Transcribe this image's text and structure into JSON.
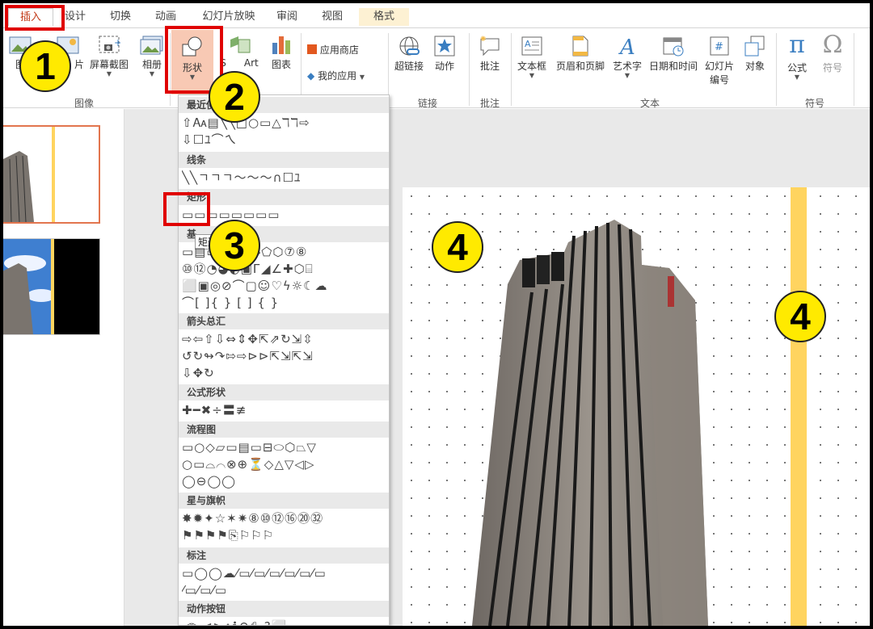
{
  "tabs": [
    {
      "label": "插入",
      "active": true
    },
    {
      "label": "设计"
    },
    {
      "label": "切换"
    },
    {
      "label": "动画"
    },
    {
      "label": "幻灯片放映"
    },
    {
      "label": "审阅"
    },
    {
      "label": "视图"
    },
    {
      "label": "格式",
      "context": true
    }
  ],
  "ribbon": {
    "images_group": {
      "label": "图像",
      "picture_label": "图",
      "online_picture_label": "片",
      "screenshot_label": "屏幕截图",
      "album_label": "相册"
    },
    "illustrations": {
      "shapes_label": "形状",
      "smartart_label_a": "S",
      "smartart_label_b": "Art",
      "chart_label": "图表"
    },
    "apps": {
      "store_label": "应用商店",
      "myapps_label": "我的应用"
    },
    "links_group": {
      "label": "链接",
      "hyperlink_label": "超链接",
      "action_label": "动作"
    },
    "comments_group": {
      "label": "批注",
      "comment_label": "批注"
    },
    "text_group": {
      "label": "文本",
      "textbox_label": "文本框",
      "header_footer_label": "页眉和页脚",
      "wordart_label": "艺术字",
      "datetime_label": "日期和时间",
      "slide_number_label_1": "幻灯片",
      "slide_number_label_2": "编号",
      "object_label": "对象"
    },
    "symbols_group": {
      "label": "符号",
      "equation_label": "公式",
      "symbol_label": "符号"
    }
  },
  "shapes_menu": {
    "recent_title": "最近使",
    "lines_title": "线条",
    "rect_title": "矩形",
    "basic_title": "基",
    "arrows_title": "箭头总汇",
    "equation_title": "公式形状",
    "flowchart_title": "流程图",
    "stars_title": "星与旗帜",
    "callouts_title": "标注",
    "action_title": "动作按钮",
    "tooltip": "矩形",
    "rows": {
      "recent_1": "⇧🗛▤╲╲□○▭△ℸℸ⇨",
      "recent_2": "⇩☐ﾕ⌒ㄟ",
      "lines_1": "╲╲ㄱㄱㄱ～～～∩☐ﾕ",
      "rect_1": "▭▭▭▭▭▭▭▭",
      "basic_1": "▭▤▭▭▱◁◇⬠⬡⑦⑧",
      "basic_2": "⑩⑫◔◕◐▣Г◢∠✚⬡⌸",
      "basic_3": "⬜▣◎⊘⌒▢☺♡ϟ☼☾☁",
      "basic_4": "⌒[ ]{ } [ ] { }",
      "arrows_1": "⇨⇦⇧⇩⇔⇕✥⇱⇗↻⇲⇳",
      "arrows_2": "↺↻↬↷⇰⇨⊳⊳⇱⇲⇱⇲",
      "arrows_3": "⇩✥↻",
      "equation_1": "✚━✖÷〓≢",
      "flow_1": "▭○◇▱▭▤▭⊟⬭⬡⏢▽",
      "flow_2": "○▭⌓⌒⊗⊕⏳◇△▽◁▷",
      "flow_3": "◯⊖◯◯",
      "stars_1": "✸✹✦☆✶✷⑧⑩⑫⑯⑳㉜",
      "stars_2": "⚑⚑⚑⚑⎘⚐⚐⚐",
      "callouts_1": "▭◯◯☁⁄▭⁄▭⁄▭⁄▭⁄▭⁄▭",
      "callouts_2": "⁄▭⁄▭⁄▭",
      "action_1": "◁▷⊲⊳⌂ℹ↶⎙ ?⬜"
    }
  },
  "callouts": [
    "1",
    "2",
    "3",
    "4",
    "4"
  ]
}
